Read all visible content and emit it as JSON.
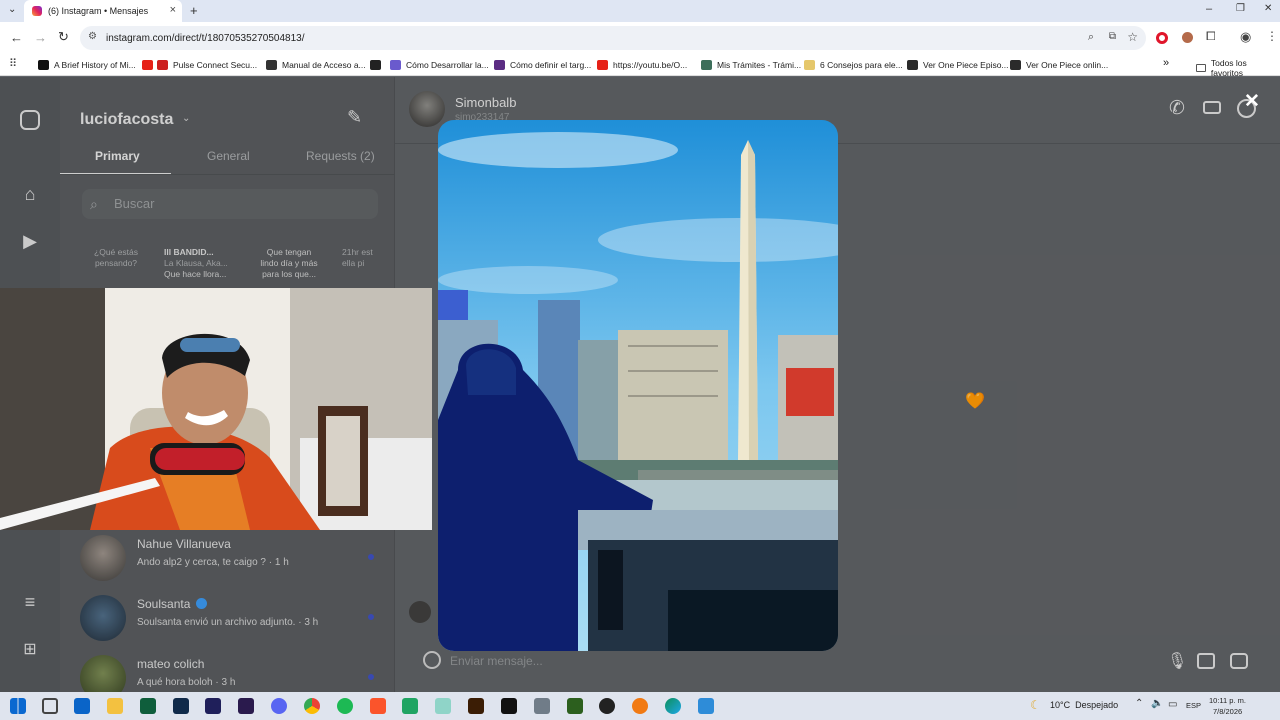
{
  "browser": {
    "tab_title": "(6) Instagram • Mensajes",
    "tab_close": "×",
    "new_tab": "+",
    "url": "instagram.com/direct/t/18070535270504813/",
    "window_controls": [
      "–",
      "❐",
      "✕"
    ],
    "bookmarks": [
      {
        "label": "A Brief History of Mi...",
        "color": "#111111"
      },
      {
        "label": "",
        "color": "#e62117"
      },
      {
        "label": "Pulse Connect Secu...",
        "color": "#cc1f1f"
      },
      {
        "label": "Manual de Acceso a...",
        "color": "#333333"
      },
      {
        "label": "",
        "color": "#222222"
      },
      {
        "label": "Cómo Desarrollar la...",
        "color": "#6a5acd"
      },
      {
        "label": "Cómo definir el targ...",
        "color": "#5b2c83"
      },
      {
        "label": "https://youtu.be/O...",
        "color": "#e62117"
      },
      {
        "label": "Mis Trámites - Trámi...",
        "color": "#3c6e5a"
      },
      {
        "label": "6 Consejos para ele...",
        "color": "#e5c76b"
      },
      {
        "label": "Ver One Piece Episo...",
        "color": "#2b2b2b"
      },
      {
        "label": "Ver One Piece onlin...",
        "color": "#2b2b2b"
      }
    ],
    "bookmarks_more": "»",
    "all_bookmarks": "Todos los favoritos"
  },
  "instagram": {
    "username": "luciofacosta",
    "tabs": [
      {
        "label": "Primary",
        "active": true
      },
      {
        "label": "General",
        "active": false
      },
      {
        "label": "Requests (2)",
        "active": false
      }
    ],
    "search_placeholder": "Buscar",
    "notes": [
      {
        "line1": "¿Qué estás",
        "line2": "pensando?",
        "line3": ""
      },
      {
        "line1": "Ill BANDID...",
        "line2": "La Klausa, Aka...",
        "line3": "Que hace llora..."
      },
      {
        "line1": "Que tengan",
        "line2": "lindo día y más",
        "line3": "para los que..."
      },
      {
        "line1": "21hr est",
        "line2": "ella pi",
        "line3": ""
      }
    ],
    "conversations": [
      {
        "name": "Nahue Villanueva",
        "message": "Ando alp2 y cerca, te caigo ? · 1 h",
        "verified": false
      },
      {
        "name": "Soulsanta",
        "message": "Soulsanta envió un archivo adjunto. · 3 h",
        "verified": true
      },
      {
        "name": "mateo colich",
        "message": "A qué hora boloh · 3 h",
        "verified": false
      }
    ],
    "chat": {
      "contact_name": "Simonbalb",
      "contact_handle": "simo233147",
      "message_placeholder": "Enviar mensaje...",
      "close_label": "✕"
    }
  },
  "taskbar": {
    "weather": "10°C  Despejado",
    "language": "ESP",
    "time": "10:11 p. m.",
    "date": "7/8/2026"
  },
  "colors": {
    "accent": "#3b4dc0",
    "verified": "#3897f0"
  }
}
